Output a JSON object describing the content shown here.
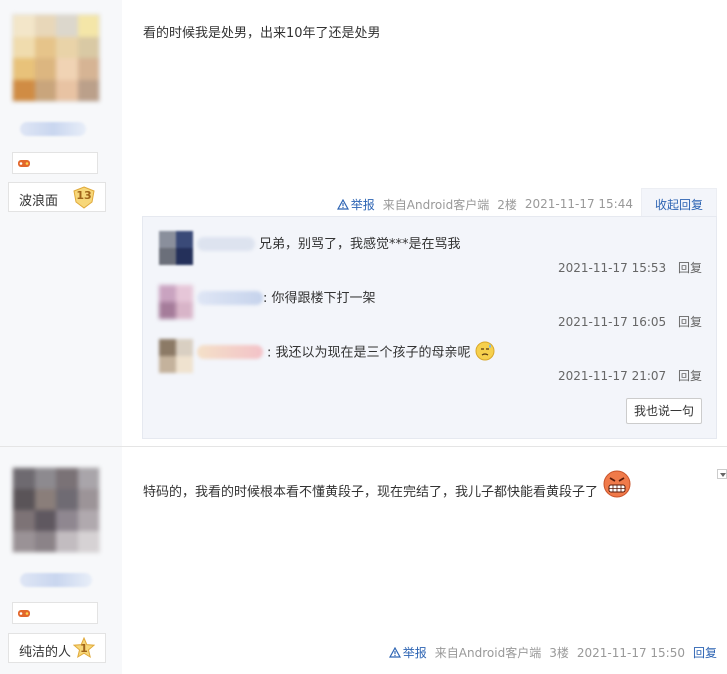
{
  "posts": [
    {
      "level_name": "波浪面",
      "level_num": "13",
      "content": "看的时候我是处男，出来10年了还是处男",
      "tail": {
        "report": "举报",
        "client": "来自Android客户端",
        "floor": "2楼",
        "time": "2021-11-17 15:44",
        "fold": "收起回复"
      },
      "comments": [
        {
          "text": "兄弟，别骂了，我感觉***是在骂我",
          "time": "2021-11-17 15:53",
          "reply": "回复"
        },
        {
          "text": ": 你得跟楼下打一架",
          "time": "2021-11-17 16:05",
          "reply": "回复"
        },
        {
          "text": ": 我还以为现在是三个孩子的母亲呢",
          "time": "2021-11-17 21:07",
          "reply": "回复"
        }
      ],
      "say_button": "我也说一句"
    },
    {
      "level_name": "纯洁的人",
      "level_num": "1",
      "content": "特码的，我看的时候根本看不懂黄段子，现在完结了，我儿子都快能看黄段子了",
      "tail": {
        "report": "举报",
        "client": "来自Android客户端",
        "floor": "3楼",
        "time": "2021-11-17 15:50",
        "reply": "回复"
      }
    }
  ],
  "colors": {
    "link": "#2d64b3",
    "meta": "#999999",
    "sidebar_bg": "#f7f8fa",
    "comment_bg": "#f3f5fa",
    "badge_gold": "#f5c542"
  },
  "icons": [
    "warning-triangle-icon",
    "level-badge-icon",
    "sweat-emoji-icon",
    "angry-grin-emoji-icon",
    "dropdown-arrow-icon"
  ]
}
